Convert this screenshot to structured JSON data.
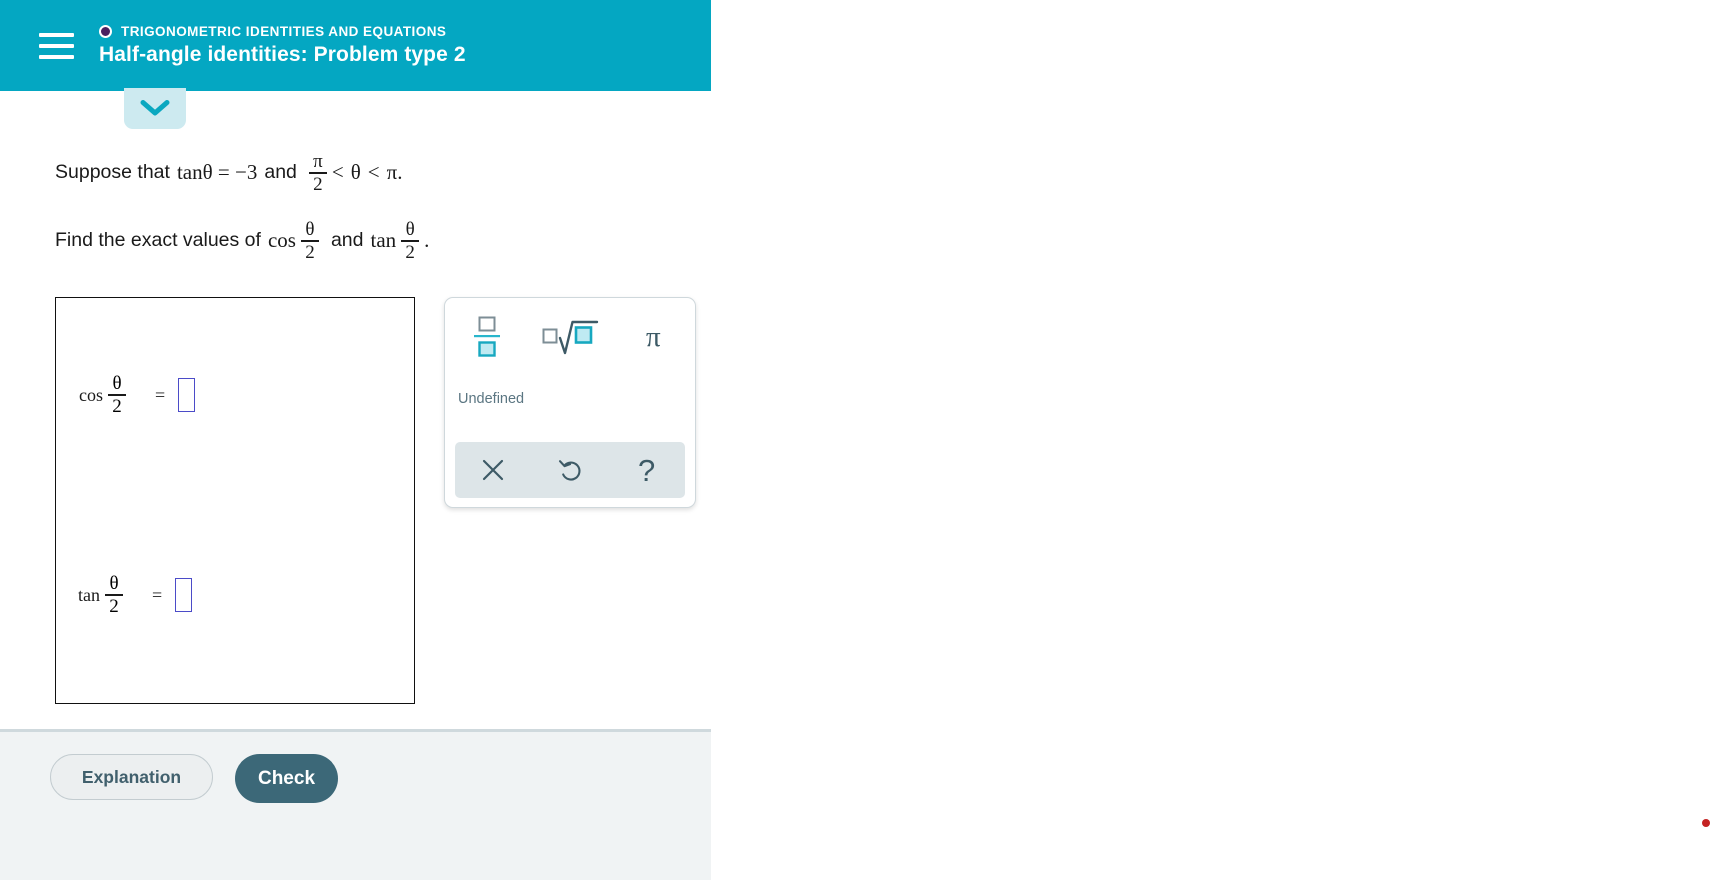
{
  "header": {
    "menu_icon": "hamburger-menu-icon",
    "breadcrumb_icon": "circle-icon",
    "breadcrumb": "TRIGONOMETRIC IDENTITIES AND EQUATIONS",
    "title": "Half-angle identities: Problem type 2",
    "background_color": "#04a7c2"
  },
  "expand_tab": {
    "icon": "chevron-down-icon",
    "background_color": "#cdeaf0",
    "icon_color": "#04a7c2"
  },
  "problem": {
    "line1": {
      "prefix": "Suppose that",
      "equation": "tanθ = −3",
      "conjunction": "and",
      "frac_num": "π",
      "frac_den": "2",
      "inequality_left": "<",
      "variable": "θ",
      "inequality_right": "<",
      "bound": "π",
      "period": "."
    },
    "line2": {
      "prefix": "Find the exact values of",
      "fn1": "cos",
      "fn1_num": "θ",
      "fn1_den": "2",
      "conjunction": "and",
      "fn2": "tan",
      "fn2_num": "θ",
      "fn2_den": "2",
      "period": "."
    }
  },
  "answers": [
    {
      "function": "cos",
      "arg_num": "θ",
      "arg_den": "2",
      "equals": "=",
      "value": "",
      "placeholder": ""
    },
    {
      "function": "tan",
      "arg_num": "θ",
      "arg_den": "2",
      "equals": "=",
      "value": "",
      "placeholder": ""
    }
  ],
  "keypad": {
    "symbols": [
      {
        "name": "fraction-button",
        "label": "□/□"
      },
      {
        "name": "square-root-button",
        "label": "□√□"
      },
      {
        "name": "pi-button",
        "label": "π"
      }
    ],
    "status": "Undefined",
    "actions": [
      {
        "name": "clear-button",
        "label": "✕"
      },
      {
        "name": "undo-button",
        "label": "↺"
      },
      {
        "name": "help-button",
        "label": "?"
      }
    ],
    "accent_color": "#29b6cc",
    "icon_color": "#3d5a66"
  },
  "footer": {
    "explanation_label": "Explanation",
    "check_label": "Check",
    "check_color": "#3c6878",
    "background_color": "#f0f3f4"
  },
  "cursor": {
    "name": "cursor-dot",
    "color": "#c42222"
  }
}
